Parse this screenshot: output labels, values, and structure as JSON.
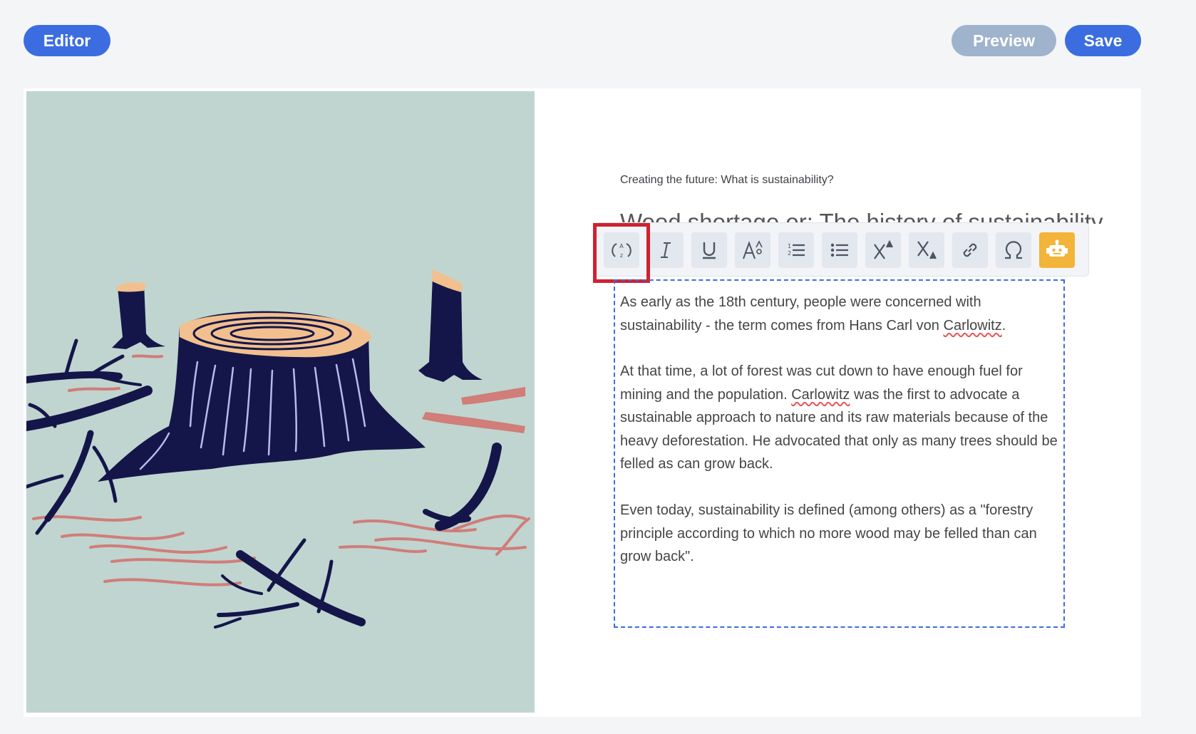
{
  "header": {
    "editor_label": "Editor",
    "preview_label": "Preview",
    "save_label": "Save"
  },
  "content": {
    "kicker": "Creating the future: What is sustainability?",
    "title": "Wood shortage or: The history of sustainability",
    "paragraphs": [
      {
        "p1a": "As early as the 18th century, people were concerned with sustainability - the term comes from Hans Carl von ",
        "p1b": "Carlowitz",
        "p1c": "."
      },
      {
        "p2a": "At that time, a lot of forest was cut down to have enough fuel for mining and the population. ",
        "p2b": "Carlowitz",
        "p2c": " was the first to advocate a sustainable approach to nature and its raw materials because of the heavy deforestation. He advocated that only as many trees should be felled as can grow back."
      },
      {
        "p3": "Even today, sustainability is defined (among others) as a \"forestry principle according to which no more wood may be felled than can grow back\"."
      }
    ]
  },
  "toolbar": {
    "buttons": [
      {
        "icon": "case-toggle-icon"
      },
      {
        "icon": "italic-icon"
      },
      {
        "icon": "underline-icon"
      },
      {
        "icon": "font-size-icon"
      },
      {
        "icon": "ordered-list-icon"
      },
      {
        "icon": "bullet-list-icon"
      },
      {
        "icon": "superscript-icon"
      },
      {
        "icon": "subscript-icon"
      },
      {
        "icon": "link-icon"
      },
      {
        "icon": "omega-icon"
      },
      {
        "icon": "robot-icon"
      }
    ]
  },
  "colors": {
    "accent": "#3b6de0",
    "preview": "#9fb3cc",
    "highlight": "#d0212f",
    "ai_button": "#f2b53a",
    "illustration_bg": "#c0d5cf",
    "stump": "#14164a",
    "stump_top": "#f2c08e",
    "branch_pink": "#d17d7a"
  }
}
